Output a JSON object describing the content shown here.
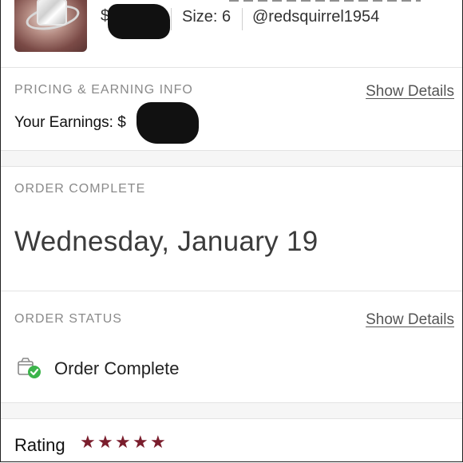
{
  "listing": {
    "price_prefix": "$",
    "size_text": "Size: 6",
    "seller": "@redsquirrel1954"
  },
  "pricing": {
    "section_label": "PRICING & EARNING INFO",
    "show_details": "Show Details",
    "earnings_prefix": "Your Earnings: $"
  },
  "order_complete": {
    "section_label": "ORDER COMPLETE",
    "date": "Wednesday, January 19"
  },
  "order_status": {
    "section_label": "ORDER STATUS",
    "show_details": "Show Details",
    "status_text": "Order Complete"
  },
  "rating": {
    "label": "Rating",
    "stars": 5,
    "star_color": "#7a1d2c"
  },
  "colors": {
    "status_check": "#3cb44b"
  }
}
